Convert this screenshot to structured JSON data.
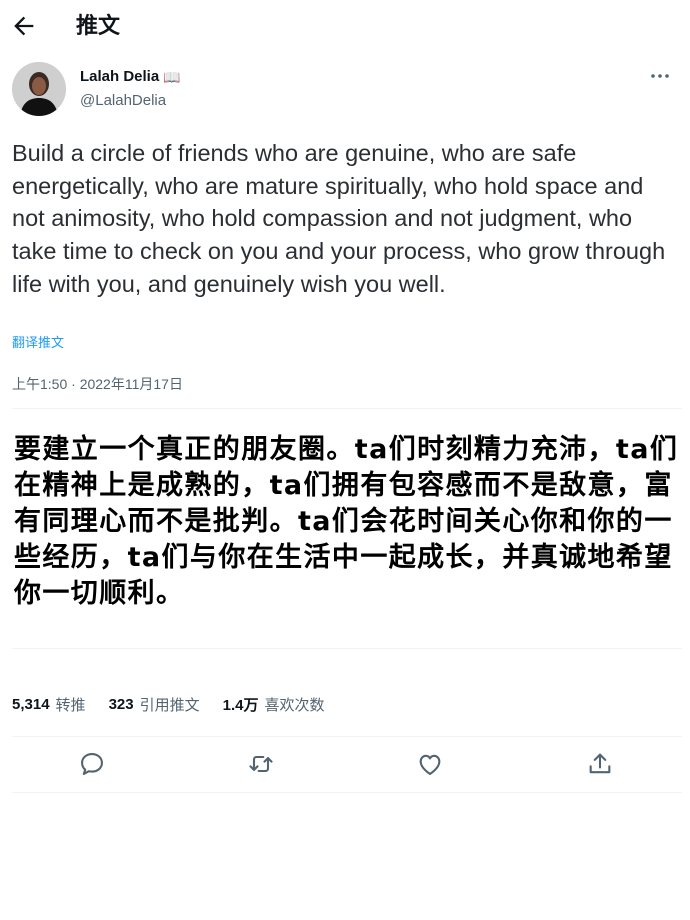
{
  "header": {
    "title": "推文"
  },
  "author": {
    "name": "Lalah Delia",
    "badge_icon": "open-book-emoji",
    "handle": "@LalahDelia"
  },
  "tweet": {
    "text": "Build a circle of friends who are genuine, who are safe energetically, who are mature spiritually, who hold space and not animosity, who hold compassion and not judgment, who take time to check on you and your process, who grow through life with you, and genuinely wish you well.",
    "translate_label": "翻译推文",
    "timestamp": "上午1:50 · 2022年11月17日"
  },
  "translation_overlay": "要建立一个真正的朋友圈。ta们时刻精力充沛，ta们在精神上是成熟的，ta们拥有包容感而不是敌意，富有同理心而不是批判。ta们会花时间关心你和你的一些经历，ta们与你在生活中一起成长，并真诚地希望你一切顺利。",
  "stats": [
    {
      "count": "5,314",
      "label": "转推"
    },
    {
      "count": "323",
      "label": "引用推文"
    },
    {
      "count": "1.4万",
      "label": "喜欢次数"
    }
  ],
  "actions": [
    "reply-icon",
    "retweet-icon",
    "like-icon",
    "share-icon"
  ],
  "colors": {
    "link": "#1d9bf0",
    "secondary_text": "#536471",
    "divider": "#eff3f4"
  }
}
